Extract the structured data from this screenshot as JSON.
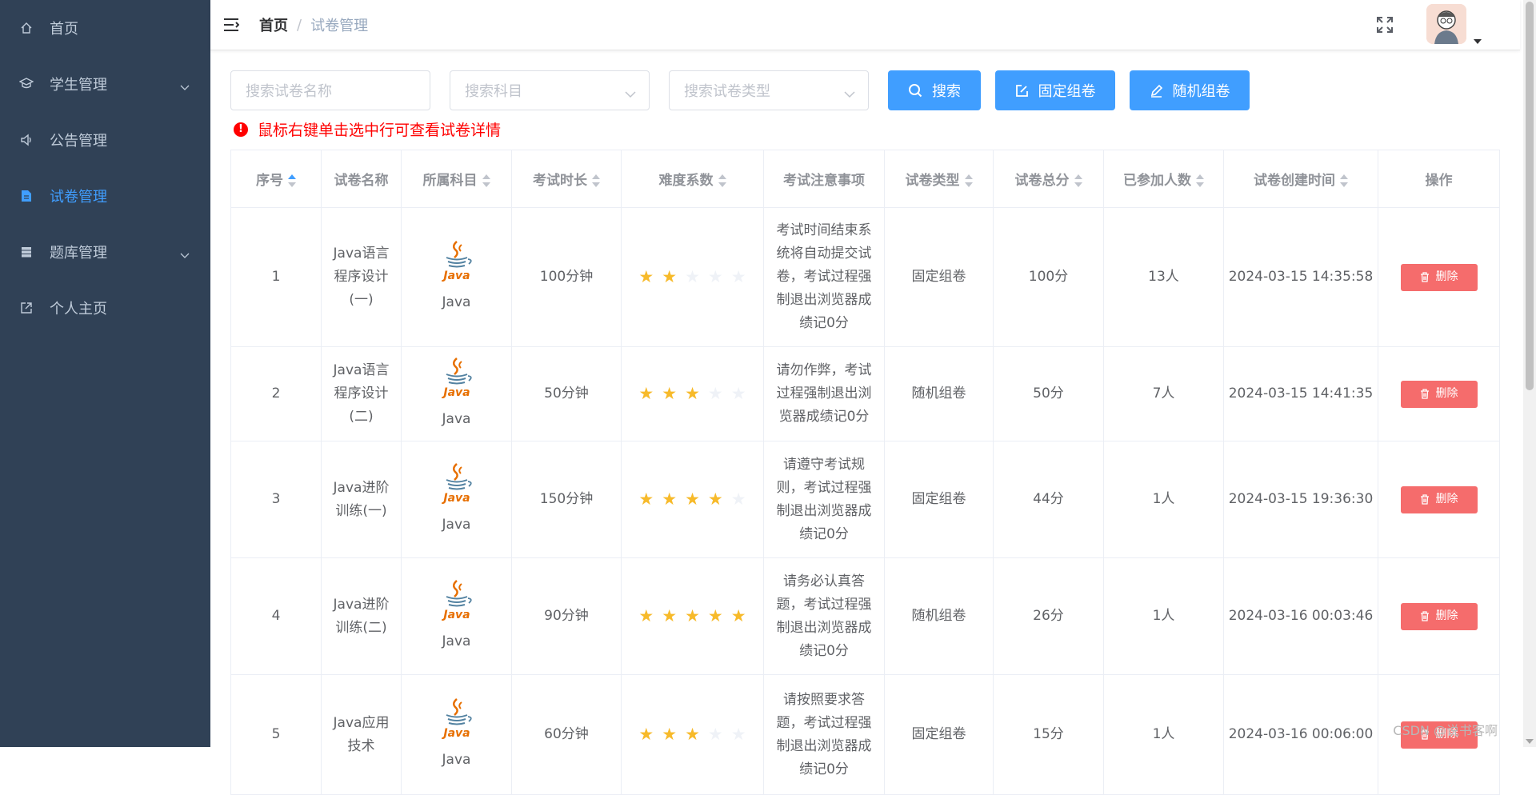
{
  "sidebar": {
    "items": [
      {
        "label": "首页",
        "icon": "home-icon"
      },
      {
        "label": "学生管理",
        "icon": "graduation-cap-icon"
      },
      {
        "label": "公告管理",
        "icon": "megaphone-icon"
      },
      {
        "label": "试卷管理",
        "icon": "document-icon"
      },
      {
        "label": "题库管理",
        "icon": "database-icon"
      },
      {
        "label": "个人主页",
        "icon": "external-link-icon"
      }
    ]
  },
  "navbar": {
    "breadcrumb_home": "首页",
    "breadcrumb_sep": "/",
    "breadcrumb_current": "试卷管理"
  },
  "search": {
    "name_placeholder": "搜索试卷名称",
    "subject_placeholder": "搜索科目",
    "type_placeholder": "搜索试卷类型",
    "search_label": "搜索",
    "fixed_label": "固定组卷",
    "random_label": "随机组卷"
  },
  "notice": {
    "text": "鼠标右键单击选中行可查看试卷详情",
    "icon": "!"
  },
  "table": {
    "headers": [
      "序号",
      "试卷名称",
      "所属科目",
      "考试时长",
      "难度系数",
      "考试注意事项",
      "试卷类型",
      "试卷总分",
      "已参加人数",
      "试卷创建时间",
      "操作"
    ],
    "rows": [
      {
        "idx": "1",
        "name": "Java语言程序设计(一)",
        "subject": "Java",
        "duration": "100分钟",
        "difficulty": 2,
        "notice": "考试时间结束系统将自动提交试卷，考试过程强制退出浏览器成绩记0分",
        "type": "固定组卷",
        "score": "100分",
        "participants": "13人",
        "created": "2024-03-15 14:35:58",
        "action": "删除"
      },
      {
        "idx": "2",
        "name": "Java语言程序设计(二)",
        "subject": "Java",
        "duration": "50分钟",
        "difficulty": 3,
        "notice": "请勿作弊，考试过程强制退出浏览器成绩记0分",
        "type": "随机组卷",
        "score": "50分",
        "participants": "7人",
        "created": "2024-03-15 14:41:35",
        "action": "删除"
      },
      {
        "idx": "3",
        "name": "Java进阶训练(一)",
        "subject": "Java",
        "duration": "150分钟",
        "difficulty": 4,
        "notice": "请遵守考试规则，考试过程强制退出浏览器成绩记0分",
        "type": "固定组卷",
        "score": "44分",
        "participants": "1人",
        "created": "2024-03-15 19:36:30",
        "action": "删除"
      },
      {
        "idx": "4",
        "name": "Java进阶训练(二)",
        "subject": "Java",
        "duration": "90分钟",
        "difficulty": 5,
        "notice": "请务必认真答题，考试过程强制退出浏览器成绩记0分",
        "type": "随机组卷",
        "score": "26分",
        "participants": "1人",
        "created": "2024-03-16 00:03:46",
        "action": "删除"
      },
      {
        "idx": "5",
        "name": "Java应用技术",
        "subject": "Java",
        "duration": "60分钟",
        "difficulty": 3,
        "notice": "请按照要求答题，考试过程强制退出浏览器成绩记0分",
        "type": "固定组卷",
        "score": "15分",
        "participants": "1人",
        "created": "2024-03-16 00:06:00",
        "action": "删除"
      }
    ]
  },
  "watermark": "CSDN @说书客啊",
  "colors": {
    "sidebar_bg": "#304156",
    "accent": "#409eff",
    "danger": "#f56c6c",
    "star": "#f7ba2a"
  }
}
